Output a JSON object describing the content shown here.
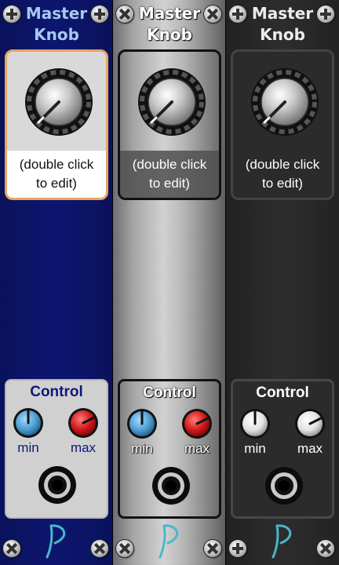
{
  "modules": [
    {
      "theme": "blue",
      "title_line1": "Master",
      "title_line2": "Knob",
      "display_text_line1": "(double click",
      "display_text_line2": "to edit)",
      "control_title": "Control",
      "min_label": "min",
      "max_label": "max",
      "knob_colors": {
        "min": "#5aa7d6",
        "max": "#d01818"
      },
      "accent": "#e8a461"
    },
    {
      "theme": "brushed-metal",
      "title_line1": "Master",
      "title_line2": "Knob",
      "display_text_line1": "(double click",
      "display_text_line2": "to edit)",
      "control_title": "Control",
      "min_label": "min",
      "max_label": "max",
      "knob_colors": {
        "min": "#5aa7d6",
        "max": "#d01818"
      }
    },
    {
      "theme": "dark",
      "title_line1": "Master",
      "title_line2": "Knob",
      "display_text_line1": "(double click",
      "display_text_line2": "to edit)",
      "control_title": "Control",
      "min_label": "min",
      "max_label": "max",
      "knob_colors": {
        "min": "#e6e6e6",
        "max": "#e6e6e6"
      }
    }
  ],
  "icons": {
    "screw_top_left": "screw-plus-icon",
    "screw_top_right": "screw-plus-icon",
    "screw_bottom": "screw-cross-icon",
    "jack": "audio-jack-icon",
    "brand_logo": "p-logo-icon"
  },
  "colors": {
    "logo": "#49b8c9",
    "blue_panel": "#0d1670",
    "dark_panel": "#2b2b2b"
  }
}
